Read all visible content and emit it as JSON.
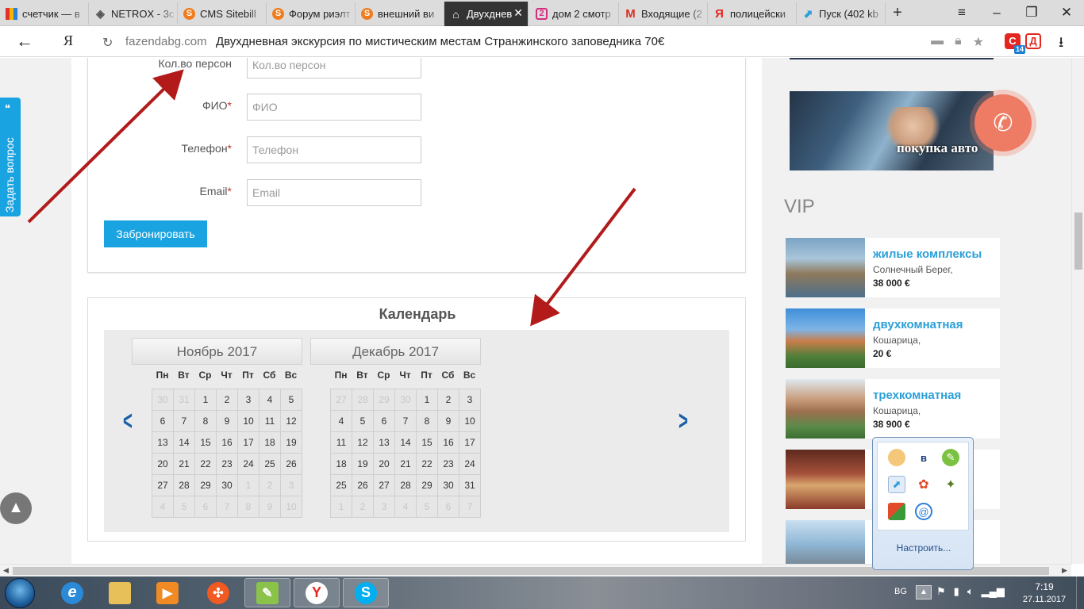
{
  "browser": {
    "tabs": [
      {
        "label": "счетчик — в",
        "icon": "yandex-metrica-icon",
        "color": "#f5b400"
      },
      {
        "label": "NETROX - 3c",
        "icon": "netrox-icon",
        "color": "#555555"
      },
      {
        "label": "CMS Sitebill",
        "icon": "sitebill-icon",
        "color": "#f07c1e"
      },
      {
        "label": "Форум риэлт",
        "icon": "sitebill-icon",
        "color": "#f07c1e"
      },
      {
        "label": "внешний ви",
        "icon": "sitebill-icon",
        "color": "#f07c1e"
      },
      {
        "label": "Двухднев",
        "icon": "home-icon",
        "color": "#ffffff",
        "active": true
      },
      {
        "label": "дом 2 смотр",
        "icon": "dom2-icon",
        "color": "#d62c7f"
      },
      {
        "label": "Входящие (2",
        "icon": "gmail-icon",
        "color": "#d93025"
      },
      {
        "label": "полицейски",
        "icon": "yandex-icon",
        "color": "#e52620"
      },
      {
        "label": "Пуск (402 kb",
        "icon": "kb-icon",
        "color": "#2a9fd8"
      }
    ],
    "address": {
      "domain": "fazendabg.com",
      "title": "Двухдневная экскурсия по мистическим местам Странжинского заповедника 70€"
    },
    "yandex_button": "Я",
    "ext_badge": "14",
    "ext_d": "Д"
  },
  "form": {
    "fields": [
      {
        "label": "Кол.во персон",
        "required": false,
        "placeholder": "Кол.во персон"
      },
      {
        "label": "ФИО",
        "required": true,
        "placeholder": "ФИО"
      },
      {
        "label": "Телефон",
        "required": true,
        "placeholder": "Телефон"
      },
      {
        "label": "Email",
        "required": true,
        "placeholder": "Email"
      }
    ],
    "required_mark": "*",
    "submit_label": "Забронировать"
  },
  "calendar": {
    "title": "Календарь",
    "weekdays": [
      "Пн",
      "Вт",
      "Ср",
      "Чт",
      "Пт",
      "Сб",
      "Вс"
    ],
    "months": [
      {
        "name": "Ноябрь 2017",
        "days": [
          [
            "30",
            1
          ],
          [
            "31",
            1
          ],
          [
            "1",
            0
          ],
          [
            "2",
            0
          ],
          [
            "3",
            0
          ],
          [
            "4",
            0
          ],
          [
            "5",
            0
          ],
          [
            "6",
            0
          ],
          [
            "7",
            0
          ],
          [
            "8",
            0
          ],
          [
            "9",
            0
          ],
          [
            "10",
            0
          ],
          [
            "11",
            0
          ],
          [
            "12",
            0
          ],
          [
            "13",
            0
          ],
          [
            "14",
            0
          ],
          [
            "15",
            0
          ],
          [
            "16",
            0
          ],
          [
            "17",
            0
          ],
          [
            "18",
            0
          ],
          [
            "19",
            0
          ],
          [
            "20",
            0
          ],
          [
            "21",
            0
          ],
          [
            "22",
            0
          ],
          [
            "23",
            0
          ],
          [
            "24",
            0
          ],
          [
            "25",
            0
          ],
          [
            "26",
            0
          ],
          [
            "27",
            0
          ],
          [
            "28",
            0
          ],
          [
            "29",
            0
          ],
          [
            "30",
            0
          ],
          [
            "1",
            1
          ],
          [
            "2",
            1
          ],
          [
            "3",
            1
          ],
          [
            "4",
            1
          ],
          [
            "5",
            1
          ],
          [
            "6",
            1
          ],
          [
            "7",
            1
          ],
          [
            "8",
            1
          ],
          [
            "9",
            1
          ],
          [
            "10",
            1
          ]
        ]
      },
      {
        "name": "Декабрь 2017",
        "days": [
          [
            "27",
            1
          ],
          [
            "28",
            1
          ],
          [
            "29",
            1
          ],
          [
            "30",
            1
          ],
          [
            "1",
            0
          ],
          [
            "2",
            0
          ],
          [
            "3",
            0
          ],
          [
            "4",
            0
          ],
          [
            "5",
            0
          ],
          [
            "6",
            0
          ],
          [
            "7",
            0
          ],
          [
            "8",
            0
          ],
          [
            "9",
            0
          ],
          [
            "10",
            0
          ],
          [
            "11",
            0
          ],
          [
            "12",
            0
          ],
          [
            "13",
            0
          ],
          [
            "14",
            0
          ],
          [
            "15",
            0
          ],
          [
            "16",
            0
          ],
          [
            "17",
            0
          ],
          [
            "18",
            0
          ],
          [
            "19",
            0
          ],
          [
            "20",
            0
          ],
          [
            "21",
            0
          ],
          [
            "22",
            0
          ],
          [
            "23",
            0
          ],
          [
            "24",
            0
          ],
          [
            "25",
            0
          ],
          [
            "26",
            0
          ],
          [
            "27",
            0
          ],
          [
            "28",
            0
          ],
          [
            "29",
            0
          ],
          [
            "30",
            0
          ],
          [
            "31",
            0
          ],
          [
            "1",
            1
          ],
          [
            "2",
            1
          ],
          [
            "3",
            1
          ],
          [
            "4",
            1
          ],
          [
            "5",
            1
          ],
          [
            "6",
            1
          ],
          [
            "7",
            1
          ]
        ]
      }
    ]
  },
  "sidebar": {
    "banner_label": "покупка авто",
    "vip_title": "VIP",
    "vip_items": [
      {
        "name": "жилые комплексы",
        "location": "Солнечный Берег,",
        "price": "38 000 €"
      },
      {
        "name": "двухкомнатная",
        "location": "Кошарица,",
        "price": "20 €"
      },
      {
        "name": "трехкомнатная",
        "location": "Кошарица,",
        "price": "38 900 €"
      }
    ]
  },
  "widgets": {
    "ask_question": "Задать вопрос"
  },
  "tray_popup": {
    "customize": "Настроить..."
  },
  "taskbar": {
    "language": "BG",
    "time": "7:19",
    "date": "27.11.2017"
  },
  "colors": {
    "accent": "#1aa3e1",
    "link": "#2a9fd8",
    "annotation_arrow": "#b31b1b",
    "call_button": "#ee7b63"
  }
}
